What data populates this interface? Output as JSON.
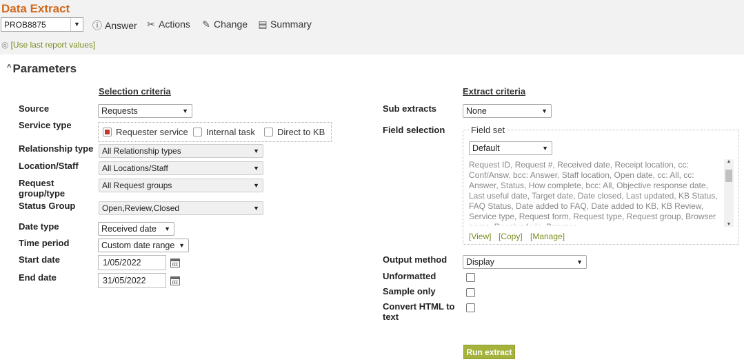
{
  "header": {
    "title": "Data Extract",
    "reference": "PROB8875",
    "toolbar": {
      "answer": "Answer",
      "actions": "Actions",
      "change": "Change",
      "summary": "Summary"
    },
    "last_values_link": "[Use last report values]"
  },
  "parameters": {
    "heading": "Parameters",
    "selection_criteria": {
      "title": "Selection criteria",
      "source": {
        "label": "Source",
        "value": "Requests"
      },
      "service_type": {
        "label": "Service type",
        "options": [
          {
            "label": "Requester service",
            "checked": true
          },
          {
            "label": "Internal task",
            "checked": false
          },
          {
            "label": "Direct to KB",
            "checked": false
          }
        ]
      },
      "relationship_type": {
        "label": "Relationship type",
        "value": "All Relationship types"
      },
      "location_staff": {
        "label": "Location/Staff",
        "value": "All Locations/Staff"
      },
      "request_group": {
        "label": "Request group/type",
        "value": "All Request groups"
      },
      "status_group": {
        "label": "Status Group",
        "value": "Open,Review,Closed"
      },
      "date_type": {
        "label": "Date type",
        "value": "Received date"
      },
      "time_period": {
        "label": "Time period",
        "value": "Custom date range"
      },
      "start_date": {
        "label": "Start date",
        "value": "1/05/2022"
      },
      "end_date": {
        "label": "End date",
        "value": "31/05/2022"
      }
    },
    "extract_criteria": {
      "title": "Extract criteria",
      "sub_extracts": {
        "label": "Sub extracts",
        "value": "None"
      },
      "field_selection": {
        "label": "Field selection",
        "legend": "Field set",
        "field_set": "Default",
        "fields": "Request ID,  Request #,  Received date,  Receipt location,  cc: Conf/Answ,  bcc: Answer,  Staff location,  Open date,  cc: All,  cc: Answer,  Status,  How complete,  bcc: All,  Objective response date,  Last useful date,  Target date,  Date closed,  Last updated,  KB Status,  FAQ Status,  Date added to FAQ,  Date added to KB,  KB Review,  Service type,  Request form,  Request type,  Request group,  Browser name,  Received via,  Browser",
        "links": {
          "view": "[View]",
          "copy": "[Copy]",
          "manage": "[Manage]"
        }
      },
      "output_method": {
        "label": "Output method",
        "value": "Display"
      },
      "unformatted": {
        "label": "Unformatted",
        "checked": false
      },
      "sample_only": {
        "label": "Sample only",
        "checked": false
      },
      "convert_html": {
        "label": "Convert HTML to text",
        "checked": false
      },
      "run_button": "Run extract"
    }
  },
  "colors": {
    "title": "#d2691e",
    "link": "#7a8c1e",
    "button": "#a5b33c",
    "checked": "#c0392b"
  }
}
